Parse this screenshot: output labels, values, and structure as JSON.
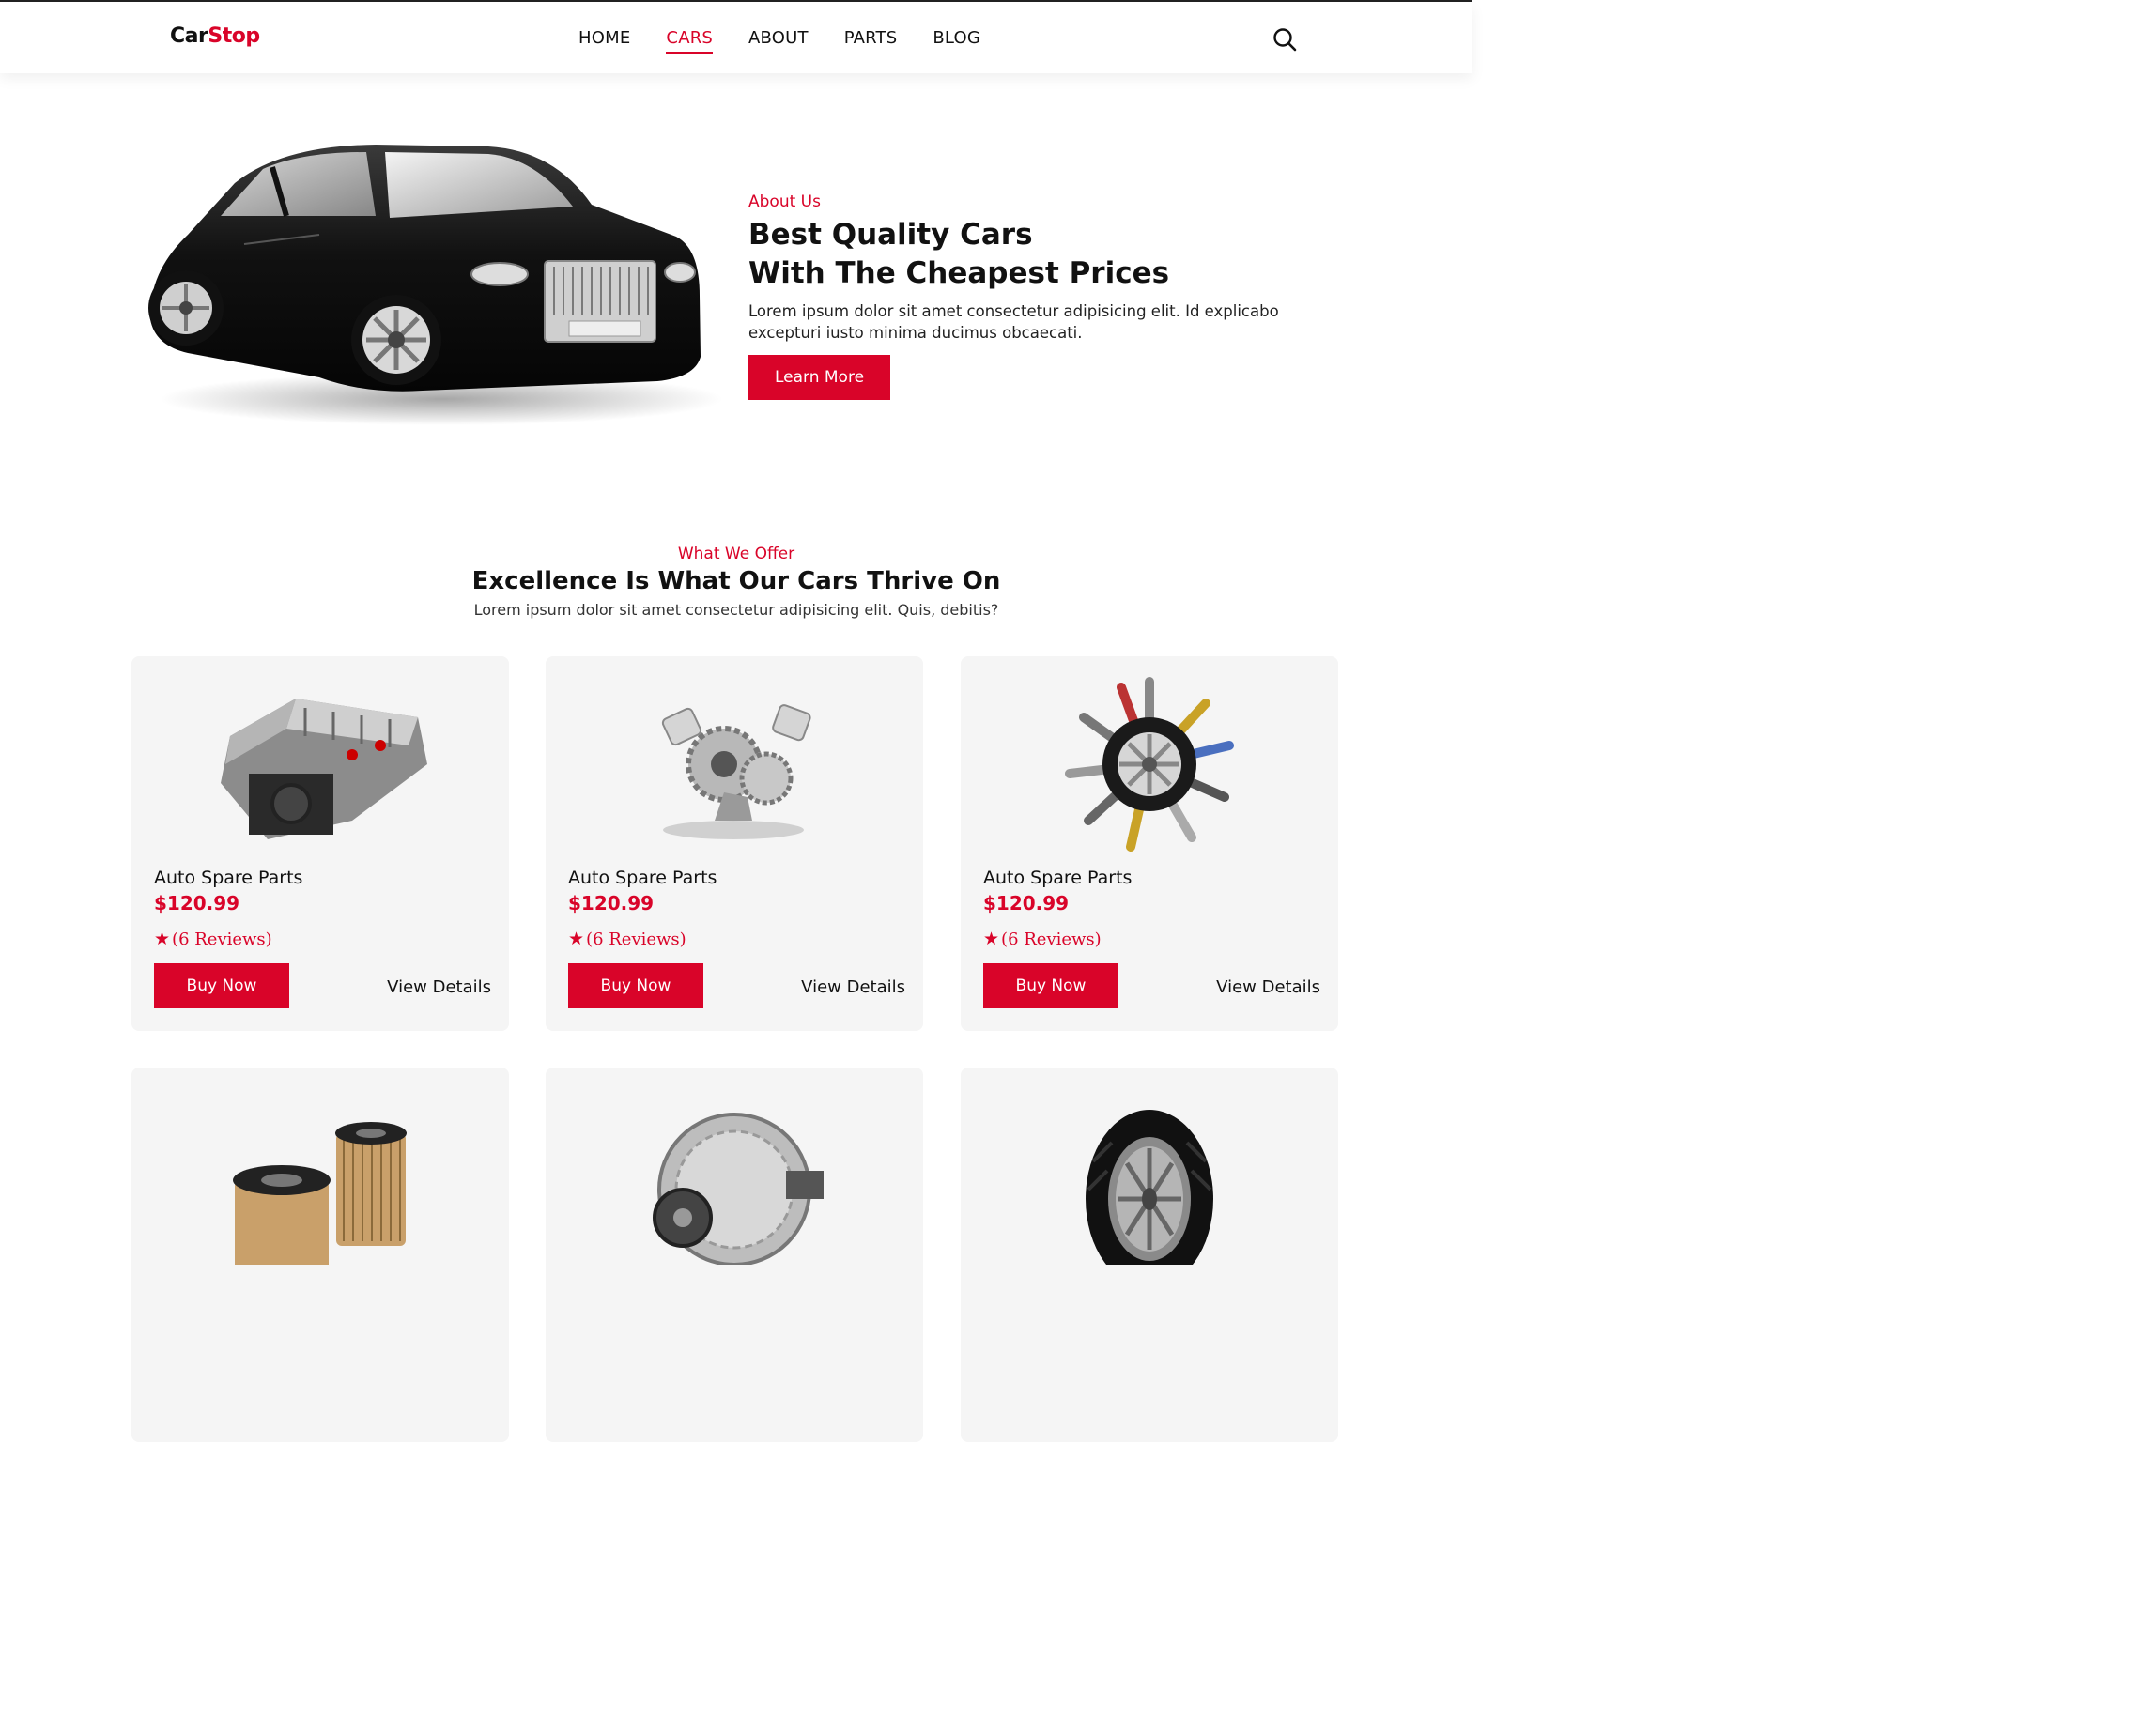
{
  "header": {
    "logo_part1": "Car",
    "logo_part2": "Stop",
    "nav": [
      "HOME",
      "CARS",
      "ABOUT",
      "PARTS",
      "BLOG"
    ],
    "active_nav": "CARS"
  },
  "hero": {
    "eyebrow": "About Us",
    "title_line1": "Best Quality Cars",
    "title_line2": "With The Cheapest Prices",
    "text": "Lorem ipsum dolor sit amet consectetur adipisicing elit. Id explicabo excepturi iusto minima ducimus obcaecati.",
    "button": "Learn More"
  },
  "offer": {
    "eyebrow": "What We Offer",
    "title": "Excellence Is What Our Cars Thrive On",
    "text": "Lorem ipsum dolor sit amet consectetur adipisicing elit. Quis, debitis?"
  },
  "products": [
    {
      "name": "Auto Spare Parts",
      "price": "$120.99",
      "reviews": "(6  Reviews)",
      "buy": "Buy Now",
      "details": "View Details",
      "image": "engine"
    },
    {
      "name": "Auto Spare Parts",
      "price": "$120.99",
      "reviews": "(6  Reviews)",
      "buy": "Buy Now",
      "details": "View Details",
      "image": "pistons-gears"
    },
    {
      "name": "Auto Spare Parts",
      "price": "$120.99",
      "reviews": "(6  Reviews)",
      "buy": "Buy Now",
      "details": "View Details",
      "image": "wheel-parts"
    },
    {
      "image": "oil-filters"
    },
    {
      "image": "alternator"
    },
    {
      "image": "tire"
    }
  ],
  "colors": {
    "accent": "#d90429",
    "card_bg": "#f5f5f5"
  }
}
